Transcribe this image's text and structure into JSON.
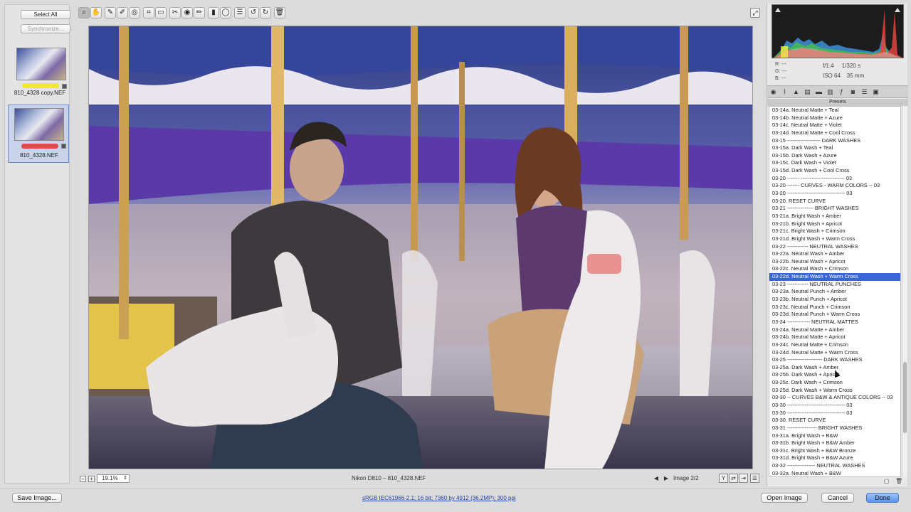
{
  "filmstrip": {
    "select_all": "Select All",
    "synchronize": "Synchronize...",
    "thumbs": [
      {
        "label": "810_4328 copy.NEF",
        "rating_color": "#f1ea2a"
      },
      {
        "label": "810_4328.NEF",
        "rating_color": "#e84848"
      }
    ]
  },
  "toolbar": {
    "tools": [
      "zoom-icon",
      "hand-icon",
      "white-balance-icon",
      "color-sampler-icon",
      "target-adjust-icon",
      "crop-icon",
      "straighten-icon",
      "spot-removal-icon",
      "red-eye-icon",
      "adjustment-brush-icon",
      "graduated-filter-icon",
      "radial-filter-icon",
      "preferences-icon",
      "rotate-left-icon",
      "rotate-right-icon",
      "trash-icon"
    ]
  },
  "status": {
    "zoom": "19.1%",
    "camera": "Nikon D810  –  810_4328.NEF",
    "image_count": "Image 2/2"
  },
  "readout": {
    "r": "R:   ---",
    "g": "G:   ---",
    "b": "B:   ---",
    "aperture": "f/1.4",
    "shutter": "1/320 s",
    "iso": "ISO 64",
    "focal": "35 mm"
  },
  "presets": {
    "header": "Presets",
    "items": [
      "03-14a. Neutral Matte + Teal",
      "03-14b. Neutral Matte + Azure",
      "03-14c. Neutral Matte + Violet",
      "03-14d. Neutral Matte + Cool Cross",
      "03-15 ------------------- DARK WASHES",
      "03-15a. Dark Wash + Teal",
      "03-15b. Dark Wash + Azure",
      "03-15c. Dark Wash + Violet",
      "03-15d. Dark Wash + Cool Cross",
      "03-20 ------- ------------------------- 03",
      "03-20 ------- CURVES - WARM COLORS -- 03",
      "03-20 --------------------------------- 03",
      "03-20. RESET CURVE",
      "03-21 --------------- BRIGHT WASHES",
      "03-21a. Bright Wash + Amber",
      "03-21b. Bright Wash + Apricot",
      "03-21c. Bright Wash + Crimson",
      "03-21d. Bright Wash + Warm Cross",
      "03-22 ------------ NEUTRAL WASHES",
      "03-22a. Neutral Wash + Amber",
      "03-22b. Neutral Wash + Apricot",
      "03-22c. Neutral Wash + Crimson",
      "03-22d. Neutral Wash + Warm Cross",
      "03-23 ------------ NEUTRAL PUNCHES",
      "03-23a. Neutral Punch + Amber",
      "03-23b. Neutral Punch + Apricot",
      "03-23c. Neutral Punch + Crimson",
      "03-23d. Neutral Punch + Warm Cross",
      "03-24 ------------- NEUTRAL MATTES",
      "03-24a. Neutral Matte + Amber",
      "03-24b. Neutral Matte + Apricot",
      "03-24c. Neutral Matte + Crimson",
      "03-24d. Neutral Matte + Warm Cross",
      "03-25 -------------------- DARK WASHES",
      "03-25a. Dark Wash + Amber",
      "03-25b. Dark Wash + Apricot",
      "03-25c. Dark Wash + Crimson",
      "03-25d. Dark Wash + Warm Cross",
      "03-30 -- CURVES B&W & ANTIQUE COLORS -- 03",
      "03-30 --------------------------------- 03",
      "03-30 --------------------------------- 03",
      "03-30. RESET CURVE",
      "03-31 ----------------- BRIGHT WASHES",
      "03-31a. Bright Wash + B&W",
      "03-31b. Bright Wash + B&W Amber",
      "03-31c. Bright Wash + B&W Bronze",
      "03-31d. Bright Wash + B&W Azure",
      "03-32 ---------------- NEUTRAL WASHES",
      "03-32a. Neutral Wash + B&W"
    ],
    "selected_index": 22
  },
  "bottom": {
    "save": "Save Image...",
    "workflow": "sRGB IEC61966-2.1; 16 bit; 7360 by 4912 (36.2MP); 300 ppi",
    "open": "Open Image",
    "cancel": "Cancel",
    "done": "Done"
  },
  "colors": {
    "selection": "#3b64d9",
    "done_button": "#5c95ea",
    "rating_yellow": "#f1ea2a",
    "rating_red": "#e84848"
  }
}
